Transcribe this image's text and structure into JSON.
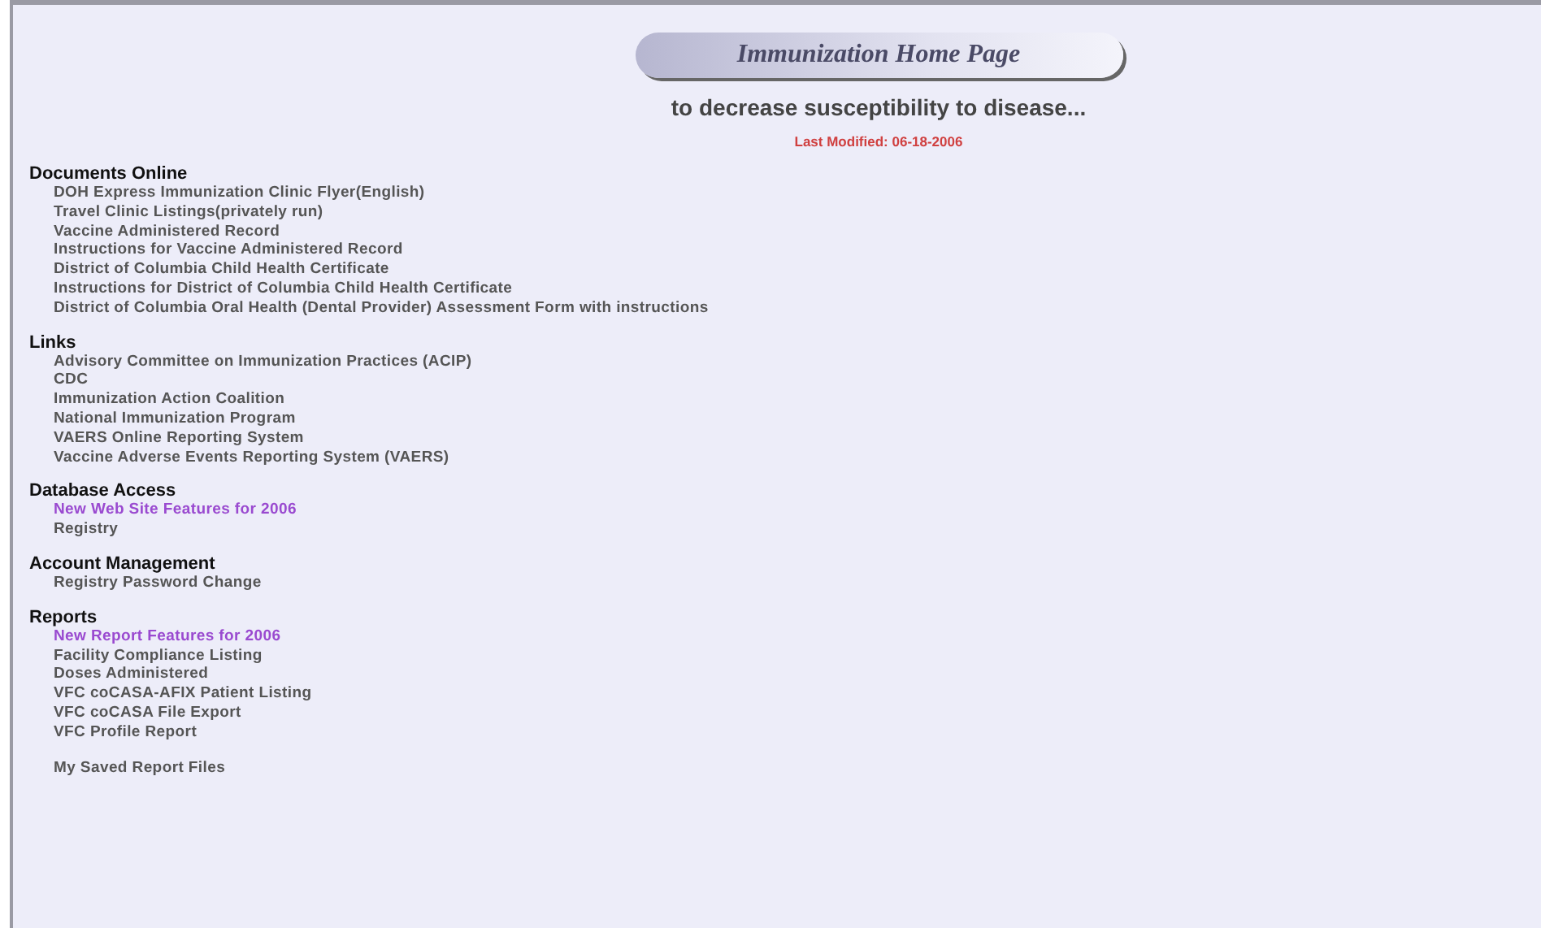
{
  "title": "Immunization Home Page",
  "tagline": "to decrease susceptibility to disease...",
  "last_modified": "Last Modified:  06-18-2006",
  "sections": [
    {
      "heading": "Documents Online",
      "items": [
        {
          "label": "DOH Express Immunization Clinic Flyer(English)",
          "visited": false
        },
        {
          "label": "Travel Clinic Listings(privately run)",
          "visited": false
        },
        {
          "label": "Vaccine Administered Record",
          "visited": false
        },
        {
          "label": "Instructions for Vaccine Administered Record",
          "visited": false
        },
        {
          "label": "District of Columbia Child Health Certificate",
          "visited": false
        },
        {
          "label": "Instructions for District of Columbia Child Health Certificate",
          "visited": false
        },
        {
          "label": "District of Columbia Oral Health (Dental Provider) Assessment Form with instructions",
          "visited": false
        }
      ]
    },
    {
      "heading": "Links",
      "items": [
        {
          "label": "Advisory Committee on Immunization Practices (ACIP)",
          "visited": false
        },
        {
          "label": "CDC",
          "visited": false
        },
        {
          "label": "Immunization Action Coalition",
          "visited": false
        },
        {
          "label": "National Immunization Program",
          "visited": false
        },
        {
          "label": "VAERS Online Reporting System",
          "visited": false
        },
        {
          "label": "Vaccine Adverse Events Reporting System (VAERS)",
          "visited": false
        }
      ]
    },
    {
      "heading": "Database Access",
      "items": [
        {
          "label": "New Web Site Features for 2006",
          "visited": true
        },
        {
          "label": "Registry",
          "visited": false
        }
      ]
    },
    {
      "heading": "Account Management",
      "items": [
        {
          "label": "Registry Password Change",
          "visited": false
        }
      ]
    },
    {
      "heading": "Reports",
      "items": [
        {
          "label": "New Report Features for 2006",
          "visited": true
        },
        {
          "label": "Facility Compliance Listing",
          "visited": false
        },
        {
          "label": "Doses Administered",
          "visited": false
        },
        {
          "label": "VFC coCASA-AFIX Patient Listing",
          "visited": false
        },
        {
          "label": "VFC coCASA File Export",
          "visited": false
        },
        {
          "label": "VFC Profile Report",
          "visited": false
        }
      ],
      "extra_items": [
        {
          "label": "My Saved Report Files",
          "visited": false
        }
      ]
    }
  ]
}
